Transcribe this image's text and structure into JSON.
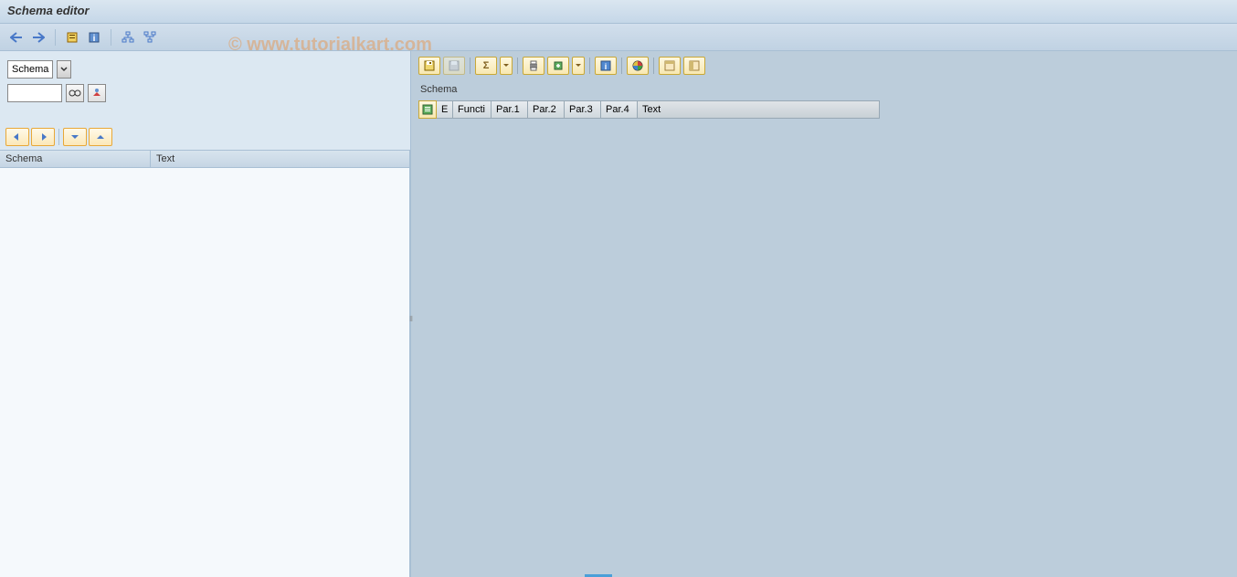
{
  "title": "Schema editor",
  "watermark": "© www.tutorialkart.com",
  "schema_selector": {
    "label": "Schema",
    "input_value": ""
  },
  "left_table": {
    "headers": {
      "schema": "Schema",
      "text": "Text"
    }
  },
  "right_section": {
    "label": "Schema",
    "grid_headers": {
      "e": "E",
      "func": "Functi",
      "par1": "Par.1",
      "par2": "Par.2",
      "par3": "Par.3",
      "par4": "Par.4",
      "text": "Text"
    }
  }
}
